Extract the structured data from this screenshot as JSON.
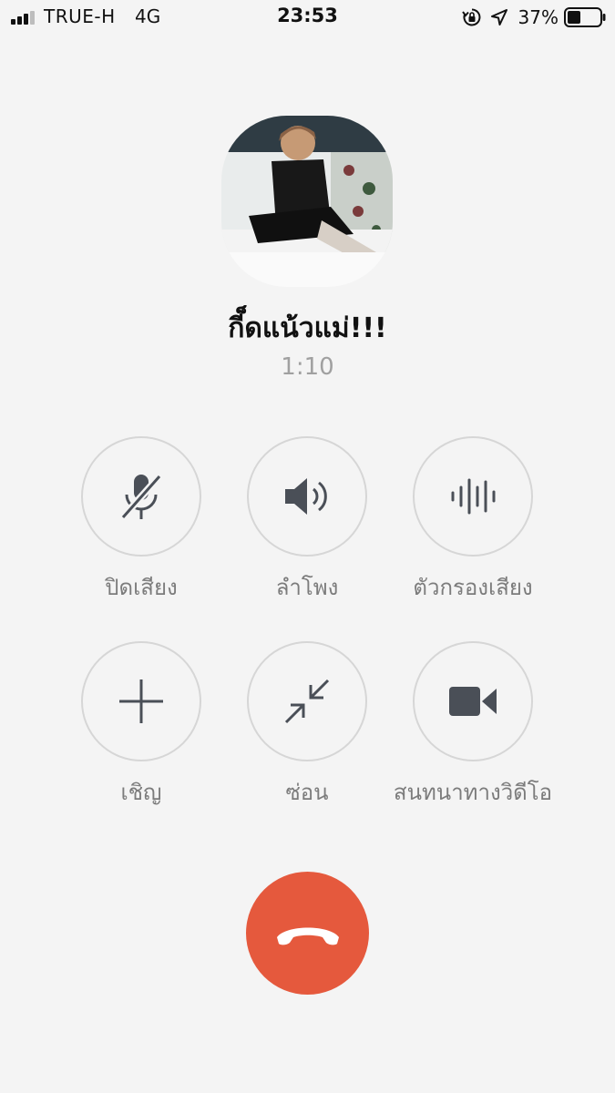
{
  "status_bar": {
    "carrier": "TRUE-H",
    "network": "4G",
    "time": "23:53",
    "battery_percent": "37%"
  },
  "call": {
    "caller_name": "กี็ดแน้วแม่!!!",
    "duration": "1:10"
  },
  "controls": [
    {
      "label": "ปิดเสียง",
      "icon": "mic-muted-icon"
    },
    {
      "label": "ลำโพง",
      "icon": "speaker-icon"
    },
    {
      "label": "ตัวกรองเสียง",
      "icon": "audio-filter-icon"
    },
    {
      "label": "เชิญ",
      "icon": "plus-icon"
    },
    {
      "label": "ซ่อน",
      "icon": "minimize-icon"
    },
    {
      "label": "สนทนาทางวิดีโอ",
      "icon": "video-camera-icon"
    }
  ],
  "colors": {
    "background": "#f4f4f4",
    "hangup": "#e5593d",
    "icon": "#4a4f57",
    "label": "#7c7c7c"
  }
}
